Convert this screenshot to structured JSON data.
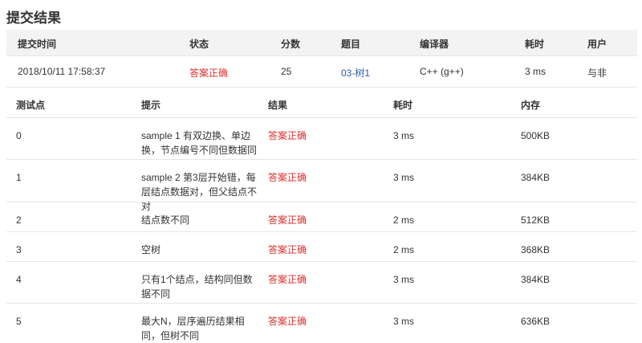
{
  "page_title": "提交结果",
  "summary": {
    "headers": [
      "提交时间",
      "状态",
      "分数",
      "题目",
      "编译器",
      "耗时",
      "用户"
    ],
    "row": {
      "time": "2018/10/11 17:58:37",
      "status": "答案正确",
      "score": "25",
      "problem": "03-树1",
      "compiler": "C++ (g++)",
      "elapsed": "3 ms",
      "user": "与非"
    },
    "colors": {
      "accepted": "#d9302c",
      "link": "#2a5db0",
      "header_bg": "#f3f3f3"
    }
  },
  "cases": {
    "headers": [
      "测试点",
      "提示",
      "结果",
      "耗时",
      "内存"
    ],
    "rows": [
      {
        "id": "0",
        "hint": "sample 1 有双边换、单边换，节点编号不同但数据同",
        "result": "答案正确",
        "time": "3 ms",
        "memory": "500KB"
      },
      {
        "id": "1",
        "hint": "sample 2 第3层开始错，每层结点数据对，但父结点不对",
        "result": "答案正确",
        "time": "3 ms",
        "memory": "384KB"
      },
      {
        "id": "2",
        "hint": "结点数不同",
        "result": "答案正确",
        "time": "2 ms",
        "memory": "512KB"
      },
      {
        "id": "3",
        "hint": "空树",
        "result": "答案正确",
        "time": "2 ms",
        "memory": "368KB"
      },
      {
        "id": "4",
        "hint": "只有1个结点，结构同但数据不同",
        "result": "答案正确",
        "time": "3 ms",
        "memory": "384KB"
      },
      {
        "id": "5",
        "hint": "最大N，层序遍历结果相同，但树不同",
        "result": "答案正确",
        "time": "3 ms",
        "memory": "636KB"
      }
    ]
  }
}
